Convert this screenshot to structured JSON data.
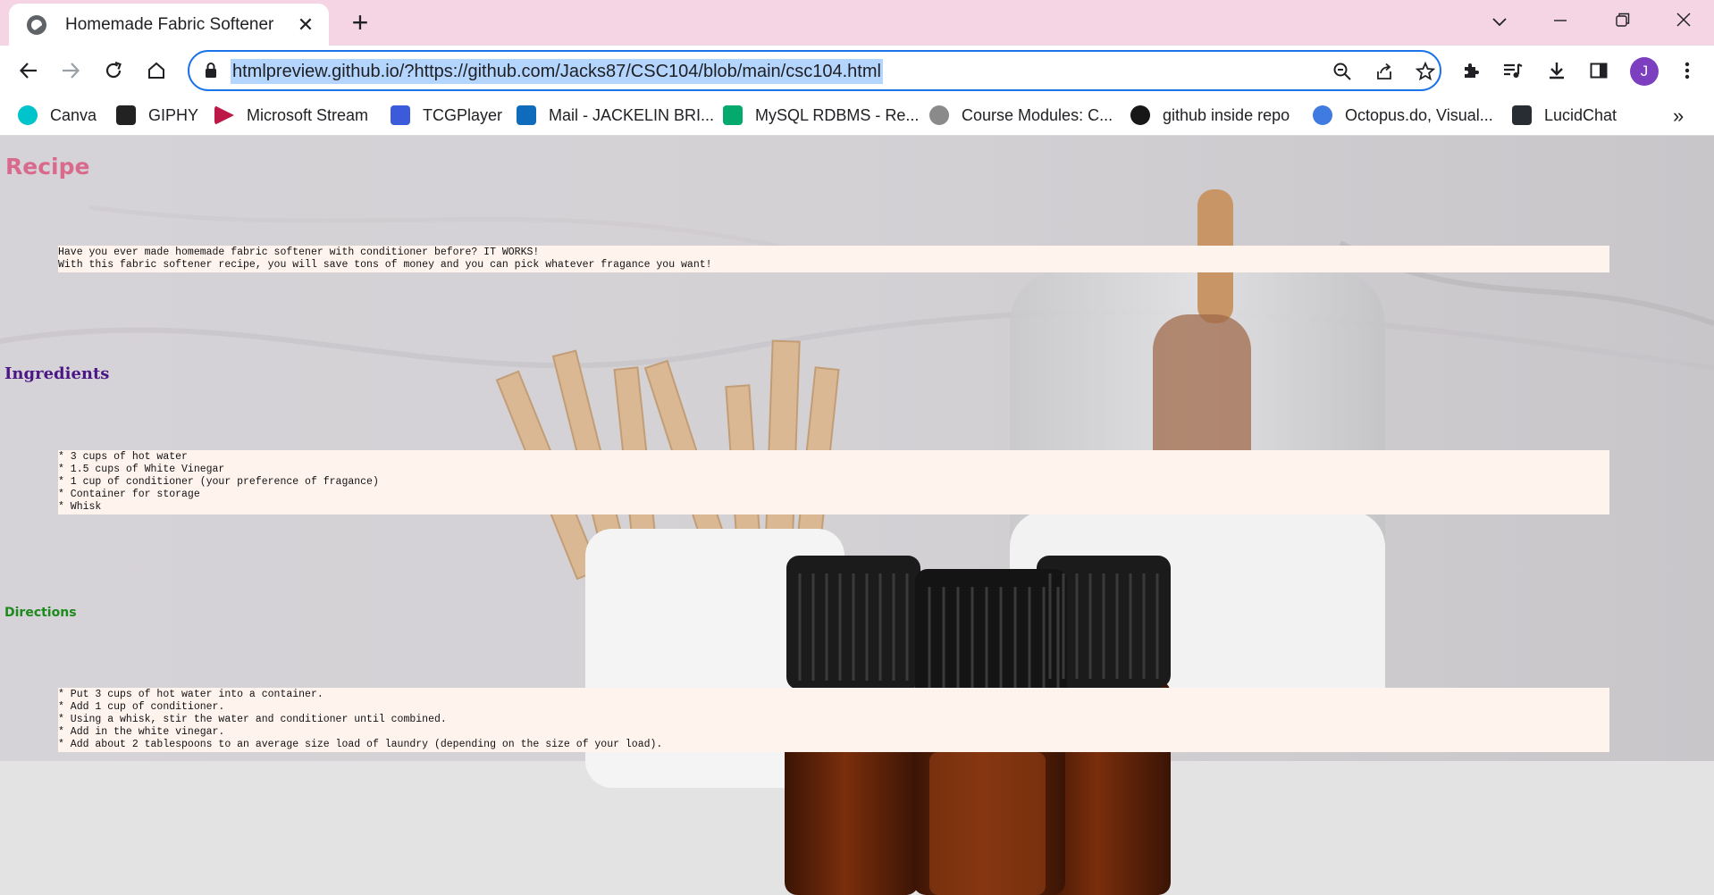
{
  "browser": {
    "tab": {
      "title": "Homemade Fabric Softener",
      "icon": "globe-icon"
    },
    "address_bar": {
      "url": "htmlpreview.github.io/?https://github.com/Jacks87/CSC104/blob/main/csc104.html"
    },
    "profile": {
      "initial": "J",
      "color": "#7b3fbf"
    },
    "bookmarks": [
      {
        "label": "Canva",
        "icon": "canva-icon",
        "color": "#00c4cc"
      },
      {
        "label": "GIPHY",
        "icon": "giphy-icon",
        "color": "#222222"
      },
      {
        "label": "Microsoft Stream",
        "icon": "stream-icon",
        "color": "#bc1948"
      },
      {
        "label": "TCGPlayer",
        "icon": "tcgplayer-icon",
        "color": "#3b5bdb"
      },
      {
        "label": "Mail - JACKELIN BRI...",
        "icon": "outlook-icon",
        "color": "#0f6cbd"
      },
      {
        "label": "MySQL RDBMS - Re...",
        "icon": "w3schools-icon",
        "color": "#04aa6d"
      },
      {
        "label": "Course Modules: C...",
        "icon": "course-icon",
        "color": "#8a8a8a"
      },
      {
        "label": "github inside repo",
        "icon": "github-icon",
        "color": "#181717"
      },
      {
        "label": "Octopus.do, Visual...",
        "icon": "octopus-icon",
        "color": "#3f7be0"
      },
      {
        "label": "LucidChat",
        "icon": "lucid-icon",
        "color": "#282c33"
      }
    ]
  },
  "page": {
    "heading": "Recipe",
    "intro": "Have you ever made homemade fabric softener with conditioner before? IT WORKS!\nWith this fabric softener recipe, you will save tons of money and you can pick whatever fragance you want!",
    "ingredients_heading": "Ingredients",
    "ingredients": "* 3 cups of hot water\n* 1.5 cups of White Vinegar\n* 1 cup of conditioner (your preference of fragance)\n* Container for storage\n* Whisk",
    "directions_heading": "Directions",
    "directions": "* Put 3 cups of hot water into a container.\n* Add 1 cup of conditioner.\n* Using a whisk, stir the water and conditioner until combined.\n* Add in the white vinegar.\n* Add about 2 tablespoons to an average size load of laundry (depending on the size of your load)."
  },
  "colors": {
    "tabstrip": "#f5d5e4",
    "accent": "#1a73e8",
    "recipe_heading": "#d96a8c",
    "ingredients_heading": "#4b1785",
    "directions_heading": "#1d8a1d",
    "box_background": "#fff3ee"
  }
}
